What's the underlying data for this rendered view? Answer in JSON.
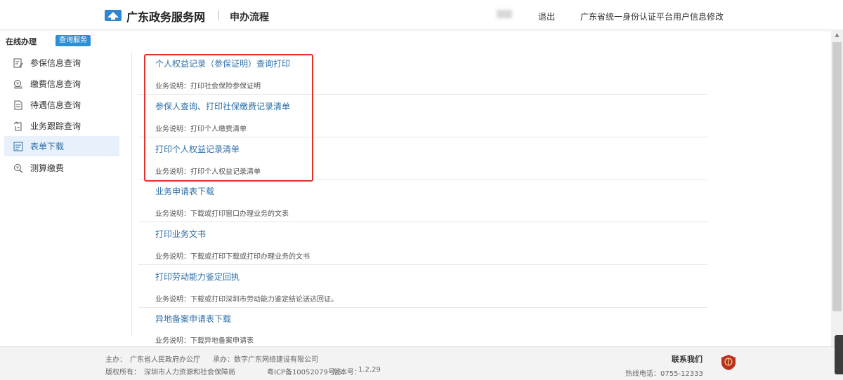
{
  "header": {
    "brand": "广东政务服务网",
    "section": "申办流程",
    "logout": "退出",
    "platform": "广东省统一身份认证平台用户信息修改"
  },
  "sidebar": {
    "title": "在线办理",
    "badge": "查询服务",
    "items": [
      {
        "label": "参保信息查询",
        "icon": "document-edit-icon"
      },
      {
        "label": "缴费信息查询",
        "icon": "payment-icon"
      },
      {
        "label": "待遇信息查询",
        "icon": "document-icon"
      },
      {
        "label": "业务跟踪查询",
        "icon": "tracking-icon"
      },
      {
        "label": "表单下载",
        "icon": "form-download-icon"
      },
      {
        "label": "测算缴费",
        "icon": "calculator-icon"
      }
    ]
  },
  "entries": [
    {
      "title": "个人权益记录（参保证明）查询打印",
      "desc": "业务说明：打印社会保险参保证明"
    },
    {
      "title": "参保人查询、打印社保缴费记录清单",
      "desc": "业务说明：打印个人缴费清单"
    },
    {
      "title": "打印个人权益记录清单",
      "desc": "业务说明：打印个人权益记录清单"
    },
    {
      "title": "业务申请表下载",
      "desc": "业务说明：下载或打印窗口办理业务的文表"
    },
    {
      "title": "打印业务文书",
      "desc": "业务说明：下载或打印下载或打印办理业务的文书"
    },
    {
      "title": "打印劳动能力鉴定回执",
      "desc": "业务说明：下载或打印深圳市劳动能力鉴定结论送达回证。"
    },
    {
      "title": "异地备案申请表下载",
      "desc": "业务说明：下载异地备案申请表"
    }
  ],
  "footer": {
    "sponsor_label": "主办：",
    "sponsor": "广东省人民政府办公厅",
    "undertaker_label": "承办：",
    "undertaker": "数字广东网络建设有限公司",
    "copyright_label": "版权所有：",
    "copyright": "深圳市人力资源和社会保障局",
    "icp": "粤ICP备10052079号-5",
    "version_label": "版本号：",
    "version": "1.2.29",
    "contact": "联系我们",
    "hotline": "热线电话：0755-12333"
  },
  "colors": {
    "accent": "#2d6fa8",
    "badge": "#2d8fd5",
    "highlight": "#e0322b"
  }
}
